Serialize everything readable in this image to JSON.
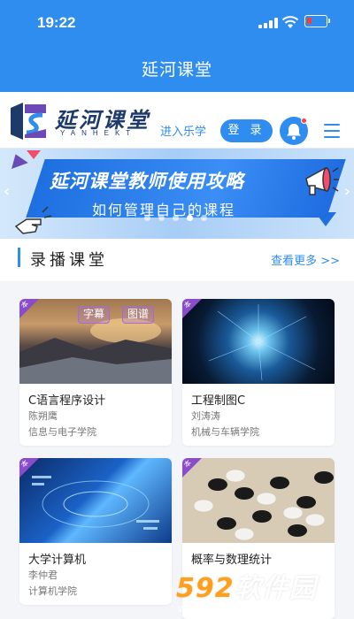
{
  "status_bar": {
    "time": "19:22"
  },
  "app": {
    "title": "延河课堂"
  },
  "brand": {
    "name": "延河课堂",
    "subtitle": "YANHEKT",
    "enter_link": "进入乐学",
    "login_label": "登 录"
  },
  "banner": {
    "title": "延河课堂教师使用攻略",
    "subtitle": "如何管理自己的课程",
    "slide_count": 5,
    "active_slide": 3
  },
  "section": {
    "title": "录播课堂",
    "more_link": "查看更多 >>"
  },
  "courses": [
    {
      "tag": "本",
      "name": "C语言程序设计",
      "teacher": "陈朔鹰",
      "college": "信息与电子学院",
      "badges": [
        "字幕",
        "图谱"
      ]
    },
    {
      "tag": "本",
      "name": "工程制图C",
      "teacher": "刘涛涛",
      "college": "机械与车辆学院",
      "badges": []
    },
    {
      "tag": "本",
      "name": "大学计算机",
      "teacher": "李仲君",
      "college": "计算机学院",
      "badges": []
    },
    {
      "tag": "本",
      "name": "概率与数理统计",
      "teacher": "",
      "college": "",
      "badges": []
    }
  ],
  "watermark": {
    "text_num": "592",
    "text_cn": "软件园",
    "url": "www.592xiazai.com"
  },
  "colors": {
    "primary": "#2f8df0",
    "tag": "#8a4dc9",
    "brand_text": "#1d3a6b"
  }
}
